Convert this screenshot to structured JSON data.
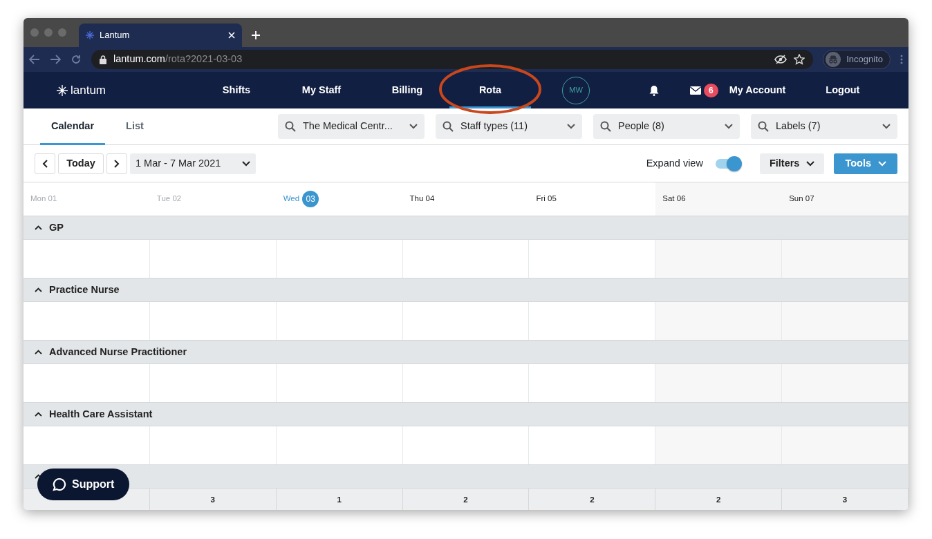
{
  "browser": {
    "tab_title": "Lantum",
    "url_host": "lantum.com",
    "url_path": "/rota?2021-03-03",
    "profile": "Incognito"
  },
  "navbar": {
    "logo": "lantum",
    "items": [
      {
        "label": "Shifts",
        "selected": false,
        "circled": false
      },
      {
        "label": "My Staff",
        "selected": false,
        "circled": false
      },
      {
        "label": "Billing",
        "selected": false,
        "circled": false
      },
      {
        "label": "Rota",
        "selected": true,
        "circled": true
      }
    ],
    "avatar": "MW",
    "messages_badge": "6",
    "account": "My Account",
    "logout": "Logout"
  },
  "view_tabs": [
    {
      "label": "Calendar",
      "selected": true
    },
    {
      "label": "List",
      "selected": false
    }
  ],
  "filters": [
    "The Medical Centr...",
    "Staff types (11)",
    "People (8)",
    "Labels (7)"
  ],
  "toolbar": {
    "today": "Today",
    "range": "1 Mar - 7 Mar 2021",
    "expand_view": {
      "label": "Expand view",
      "on": true
    },
    "filters_button": "Filters",
    "tools_button": "Tools"
  },
  "days": [
    {
      "name": "Mon",
      "date": "01",
      "kind": "past",
      "weekend": false
    },
    {
      "name": "Tue",
      "date": "02",
      "kind": "past",
      "weekend": false
    },
    {
      "name": "Wed",
      "date": "03",
      "kind": "today",
      "weekend": false
    },
    {
      "name": "Thu",
      "date": "04",
      "kind": "future",
      "weekend": false
    },
    {
      "name": "Fri",
      "date": "05",
      "kind": "future",
      "weekend": false
    },
    {
      "name": "Sat",
      "date": "06",
      "kind": "future",
      "weekend": true
    },
    {
      "name": "Sun",
      "date": "07",
      "kind": "future",
      "weekend": true
    }
  ],
  "groups": [
    {
      "name": "GP",
      "expanded": true
    },
    {
      "name": "Practice Nurse",
      "expanded": true
    },
    {
      "name": "Advanced Nurse Practitioner",
      "expanded": true
    },
    {
      "name": "Health Care Assistant",
      "expanded": true
    },
    {
      "expanded": true
    }
  ],
  "totals": [
    "3",
    "1",
    "2",
    "2",
    "2",
    "3"
  ],
  "support_button": "Support"
}
